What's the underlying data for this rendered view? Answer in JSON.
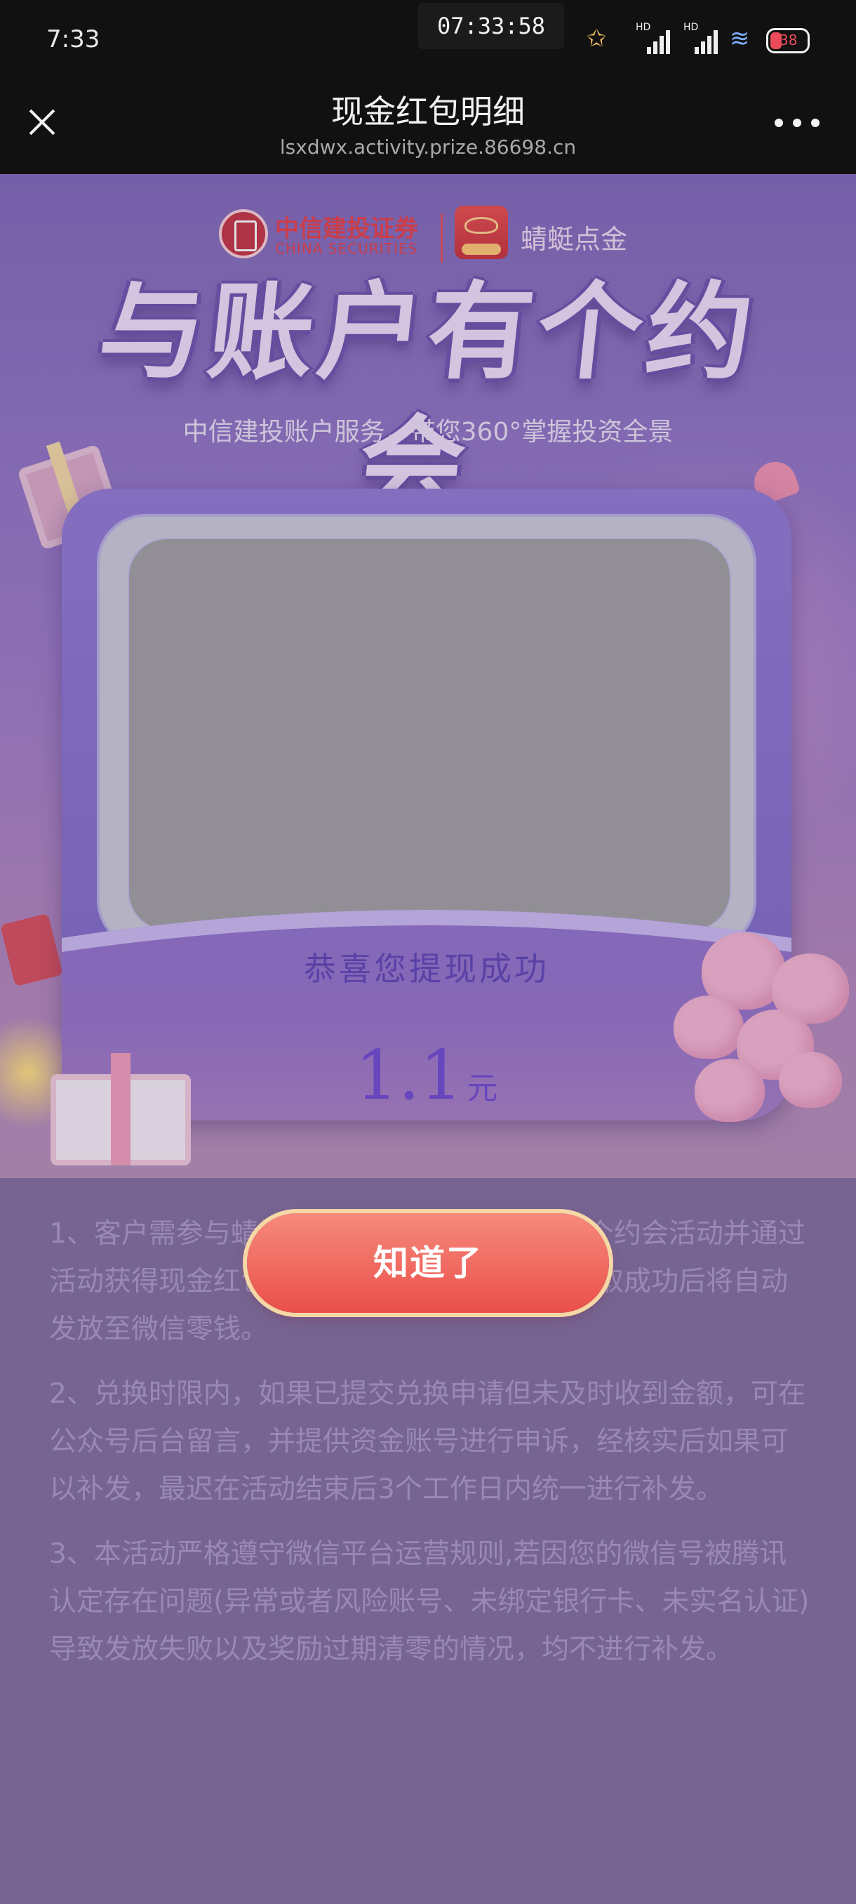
{
  "status_bar": {
    "time": "7:33",
    "clock": "07:33:58",
    "battery_level": "38",
    "hd_label": "HD"
  },
  "header": {
    "title": "现金红包明细",
    "url": "lsxdwx.activity.prize.86698.cn"
  },
  "brand": {
    "name_cn": "中信建投证券",
    "name_en": "CHINA SECURITIES",
    "app_name": "蜻蜓点金"
  },
  "banner": {
    "title": "与账户有个约会",
    "subtitle": "中信建投账户服务，带您360°掌握投资全景"
  },
  "card": {
    "congrats_text": "恭喜您提现成功",
    "amount": "1.1",
    "unit": "元"
  },
  "button": {
    "label": "知道了"
  },
  "rules": [
    "1、客户需参与蜻蜓点金小程序中的与账户有个约会活动并通过活动获得现金红包奖励即可参与本次活动，领取成功后将自动发放至微信零钱。",
    "2、兑换时限内，如果已提交兑换申请但未及时收到金额，可在公众号后台留言，并提供资金账号进行申诉，经核实后如果可以补发，最迟在活动结束后3个工作日内统一进行补发。",
    "3、本活动严格遵守微信平台运营规则,若因您的微信号被腾讯认定存在问题(异常或者风险账号、未绑定银行卡、未实名认证) 导致发放失败以及奖励过期清零的情况，均不进行补发。"
  ],
  "colors": {
    "accent_red": "#ea4f4a",
    "purple": "#7963c2",
    "page_bg": "#7d6a9c"
  }
}
